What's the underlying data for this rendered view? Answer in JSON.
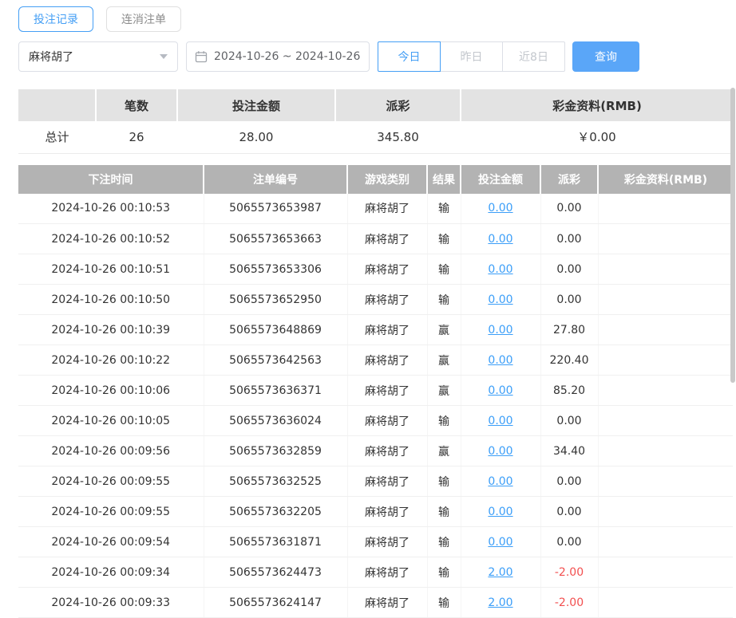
{
  "tabs": [
    {
      "label": "投注记录",
      "active": true
    },
    {
      "label": "连消注单",
      "active": false
    }
  ],
  "filters": {
    "game_select_value": "麻将胡了",
    "date_range_value": "2024-10-26 ~ 2024-10-26",
    "quick_buttons": [
      "今日",
      "昨日",
      "近8日"
    ],
    "query_button": "查询"
  },
  "summary": {
    "corner": "",
    "headers": [
      "笔数",
      "投注金额",
      "派彩",
      "彩金资料(RMB)"
    ],
    "total_label": "总计",
    "count": "26",
    "bet_amount": "28.00",
    "payout": "345.80",
    "bonus": "￥0.00"
  },
  "records": {
    "headers": [
      "下注时间",
      "注单编号",
      "游戏类别",
      "结果",
      "投注金额",
      "派彩",
      "彩金资料(RMB)"
    ],
    "rows": [
      {
        "time": "2024-10-26 00:10:53",
        "order": "5065573653987",
        "game": "麻将胡了",
        "result": "输",
        "bet": "0.00",
        "payout": "0.00",
        "bonus": ""
      },
      {
        "time": "2024-10-26 00:10:52",
        "order": "5065573653663",
        "game": "麻将胡了",
        "result": "输",
        "bet": "0.00",
        "payout": "0.00",
        "bonus": ""
      },
      {
        "time": "2024-10-26 00:10:51",
        "order": "5065573653306",
        "game": "麻将胡了",
        "result": "输",
        "bet": "0.00",
        "payout": "0.00",
        "bonus": ""
      },
      {
        "time": "2024-10-26 00:10:50",
        "order": "5065573652950",
        "game": "麻将胡了",
        "result": "输",
        "bet": "0.00",
        "payout": "0.00",
        "bonus": ""
      },
      {
        "time": "2024-10-26 00:10:39",
        "order": "5065573648869",
        "game": "麻将胡了",
        "result": "赢",
        "bet": "0.00",
        "payout": "27.80",
        "bonus": ""
      },
      {
        "time": "2024-10-26 00:10:22",
        "order": "5065573642563",
        "game": "麻将胡了",
        "result": "赢",
        "bet": "0.00",
        "payout": "220.40",
        "bonus": ""
      },
      {
        "time": "2024-10-26 00:10:06",
        "order": "5065573636371",
        "game": "麻将胡了",
        "result": "赢",
        "bet": "0.00",
        "payout": "85.20",
        "bonus": ""
      },
      {
        "time": "2024-10-26 00:10:05",
        "order": "5065573636024",
        "game": "麻将胡了",
        "result": "输",
        "bet": "0.00",
        "payout": "0.00",
        "bonus": ""
      },
      {
        "time": "2024-10-26 00:09:56",
        "order": "5065573632859",
        "game": "麻将胡了",
        "result": "赢",
        "bet": "0.00",
        "payout": "34.40",
        "bonus": ""
      },
      {
        "time": "2024-10-26 00:09:55",
        "order": "5065573632525",
        "game": "麻将胡了",
        "result": "输",
        "bet": "0.00",
        "payout": "0.00",
        "bonus": ""
      },
      {
        "time": "2024-10-26 00:09:55",
        "order": "5065573632205",
        "game": "麻将胡了",
        "result": "输",
        "bet": "0.00",
        "payout": "0.00",
        "bonus": ""
      },
      {
        "time": "2024-10-26 00:09:54",
        "order": "5065573631871",
        "game": "麻将胡了",
        "result": "输",
        "bet": "0.00",
        "payout": "0.00",
        "bonus": ""
      },
      {
        "time": "2024-10-26 00:09:34",
        "order": "5065573624473",
        "game": "麻将胡了",
        "result": "输",
        "bet": "2.00",
        "payout": "-2.00",
        "bonus": ""
      },
      {
        "time": "2024-10-26 00:09:33",
        "order": "5065573624147",
        "game": "麻将胡了",
        "result": "输",
        "bet": "2.00",
        "payout": "-2.00",
        "bonus": ""
      }
    ]
  },
  "colors": {
    "accent_blue": "#459ff5",
    "link_blue": "#3b9ef8",
    "negative_red": "#f24f4f",
    "header_gray": "#b3b3b3",
    "summary_header_gray": "#e3e3e3"
  }
}
